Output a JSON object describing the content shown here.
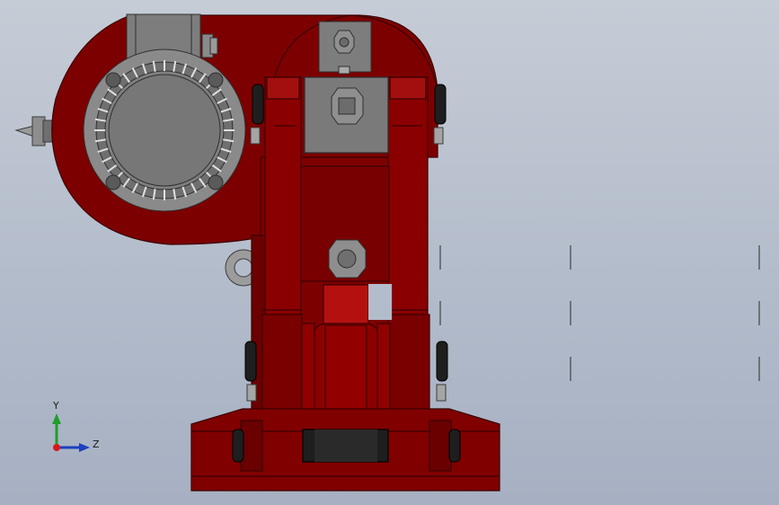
{
  "viewport": {
    "background_top": "#c6ccd6",
    "background_bottom": "#a6b0c2"
  },
  "model": {
    "body_color": "#7f0000",
    "body_highlight": "#a10d0d",
    "body_edge": "#3b0000",
    "metal_color": "#7a7a7a",
    "metal_dark": "#3c3c3c",
    "rubber_color": "#1e1e1e"
  },
  "triad": {
    "y_label": "Y",
    "z_label": "Z",
    "y_color": "#1e9e2a",
    "z_color": "#1f3fbf",
    "origin_color": "#d41a1a"
  }
}
